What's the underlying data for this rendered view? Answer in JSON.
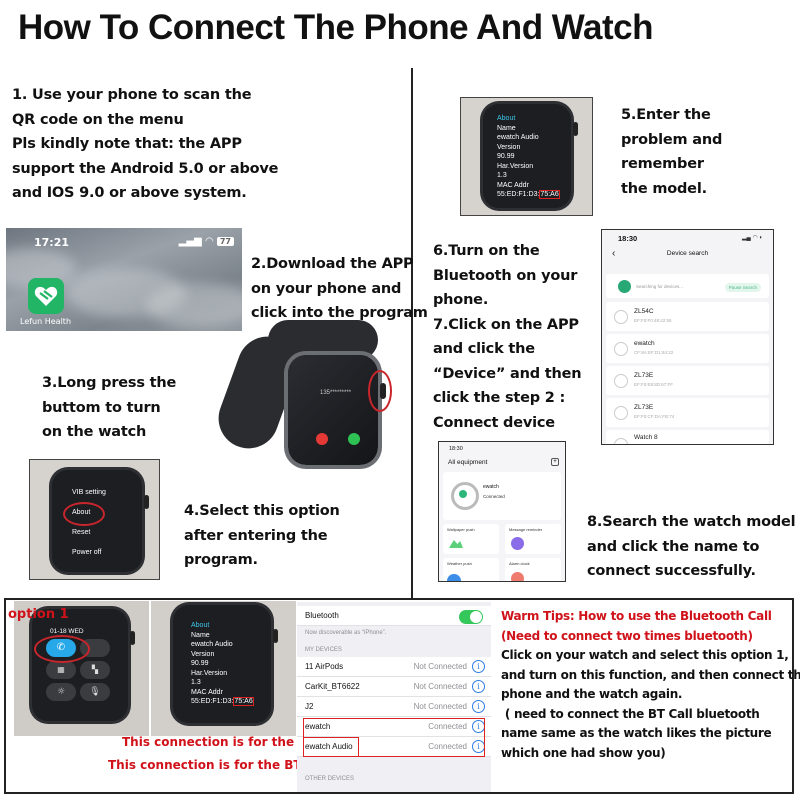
{
  "title": "How To Connect The Phone And Watch",
  "steps": {
    "step1": [
      "1. Use your phone to scan the",
      "QR code on the menu",
      "Pls kindly note that: the APP",
      "support the Android 5.0 or above",
      "and IOS 9.0 or above system."
    ],
    "step2": [
      "2.Download the APP",
      "on your phone and",
      "click into the program"
    ],
    "step3": [
      "3.Long press the",
      "buttom to turn",
      "on the watch"
    ],
    "step4": [
      "4.Select this option",
      "after entering the",
      "program."
    ],
    "step5": [
      "5.Enter the",
      "problem and",
      "remember",
      "the model."
    ],
    "step6_7": [
      "6.Turn on the",
      "Bluetooth on your",
      "phone.",
      "7.Click on the APP",
      "and click the",
      "“Device” and then",
      "click the step 2 :",
      "Connect device"
    ],
    "step8": [
      "8.Search the watch model",
      "and click the name to",
      "connect successfully."
    ]
  },
  "home_screen": {
    "time": "17:21",
    "battery": "77",
    "app_name": "Lefun Health",
    "accent": "#22b566"
  },
  "watch_call_screen": {
    "number": "135*********"
  },
  "watch_menu": {
    "items": [
      "VIB setting",
      "About",
      "Reset",
      "Power off"
    ],
    "highlighted": "About"
  },
  "watch_about": {
    "heading": "About",
    "fields": [
      {
        "label": "Name",
        "value": "ewatch Audio"
      },
      {
        "label": "Version",
        "value": "90.99"
      },
      {
        "label": "Har.Version",
        "value": "1.3"
      },
      {
        "label": "MAC Addr",
        "value": "55:ED:F1:D3:",
        "highlight": "75:A6"
      }
    ]
  },
  "device_search": {
    "time": "18:30",
    "title": "Device search",
    "searching": "Searching for devices...",
    "pause": "Pause Search",
    "devices": [
      {
        "name": "ZL54C",
        "mac": "EF:F0:F0:48:42:55"
      },
      {
        "name": "ewatch",
        "mac": "CF:8A:EF:D1:84:22"
      },
      {
        "name": "ZL73E",
        "mac": "EF:F0:E8:8D:67:FF"
      },
      {
        "name": "ZL73E",
        "mac": "EF:F0:CF:DA:FB:74"
      },
      {
        "name": "Watch 8",
        "mac": ""
      }
    ]
  },
  "all_equipment": {
    "time": "18:30",
    "title": "All equipment",
    "device_name": "ewatch",
    "status": "Connected",
    "cards": [
      "Wallpaper push",
      "Message reminder",
      "Weather push",
      "Alarm clock"
    ]
  },
  "bottom": {
    "option_label": "option 1",
    "watch_date": "01-18 WED",
    "note_app": "This connection is for the APP.",
    "note_bt": "This connection is for the BT Call",
    "bluetooth": {
      "title": "Bluetooth",
      "enabled": true,
      "discoverable": "Now discoverable as “iPhone”.",
      "my_devices": "MY DEVICES",
      "other_devices": "OTHER DEVICES",
      "devices": [
        {
          "name": "11 AirPods",
          "status": "Not Connected"
        },
        {
          "name": "CarKit_BT6622",
          "status": "Not Connected"
        },
        {
          "name": "J2",
          "status": "Not Connected"
        },
        {
          "name": "ewatch",
          "status": "Connected"
        },
        {
          "name": "ewatch Audio",
          "status": "Connected"
        }
      ]
    },
    "tips": {
      "heading": "Warm Tips: How to use the Bluetooth Call",
      "subheading": "(Need to connect two times bluetooth)",
      "lines": [
        "Click on your watch and select this option 1,",
        "and turn on this function, and then connect the",
        "phone and the watch again.",
        " ( need to connect the BT Call bluetooth",
        "name same as the watch likes the picture",
        "which one had show you)"
      ]
    }
  },
  "colors": {
    "red": "#d0121a",
    "bt_green": "#34c759",
    "ios_blue": "#2f7ee6"
  }
}
